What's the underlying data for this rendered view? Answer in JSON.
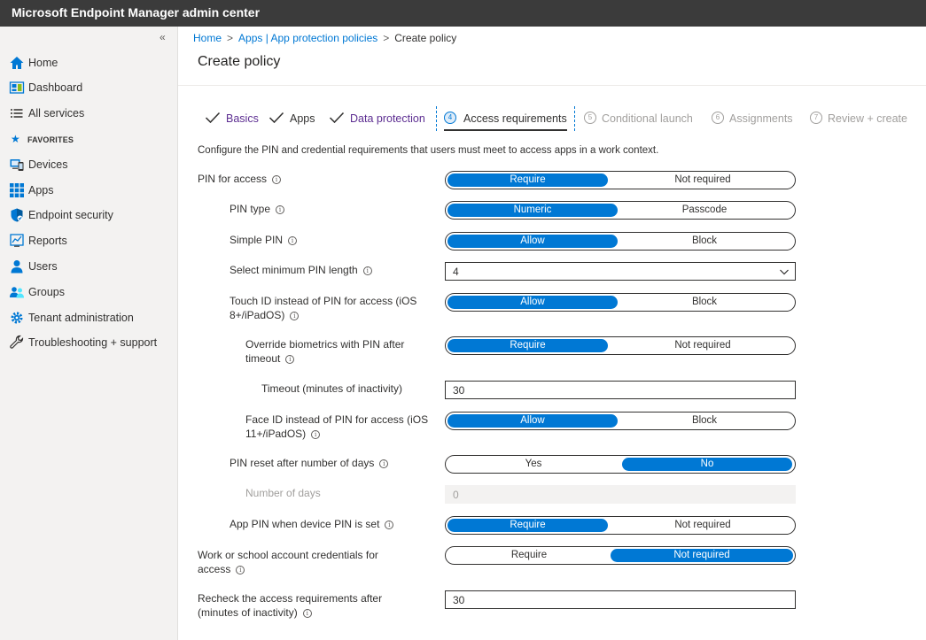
{
  "app": {
    "title": "Microsoft Endpoint Manager admin center"
  },
  "sidebar": {
    "collapse_glyph": "«",
    "favorites_label": "FAVORITES",
    "items": [
      {
        "label": "Home",
        "icon": "home-icon"
      },
      {
        "label": "Dashboard",
        "icon": "dashboard-icon"
      },
      {
        "label": "All services",
        "icon": "list-icon"
      },
      {
        "label": "Devices",
        "icon": "devices-icon"
      },
      {
        "label": "Apps",
        "icon": "apps-grid-icon"
      },
      {
        "label": "Endpoint security",
        "icon": "shield-icon"
      },
      {
        "label": "Reports",
        "icon": "reports-icon"
      },
      {
        "label": "Users",
        "icon": "user-icon"
      },
      {
        "label": "Groups",
        "icon": "groups-icon"
      },
      {
        "label": "Tenant administration",
        "icon": "tenant-gear-icon"
      },
      {
        "label": "Troubleshooting + support",
        "icon": "wrench-icon"
      }
    ]
  },
  "breadcrumb": {
    "home": "Home",
    "apps": "Apps | App protection policies",
    "current": "Create policy",
    "separator": ">"
  },
  "page": {
    "title": "Create policy"
  },
  "wizard": {
    "steps": [
      {
        "label": "Basics",
        "state": "done"
      },
      {
        "label": "Apps",
        "state": "done"
      },
      {
        "label": "Data protection",
        "state": "done"
      },
      {
        "number": "4",
        "label": "Access requirements",
        "state": "active"
      },
      {
        "number": "5",
        "label": "Conditional launch",
        "state": "upcoming"
      },
      {
        "number": "6",
        "label": "Assignments",
        "state": "upcoming"
      },
      {
        "number": "7",
        "label": "Review + create",
        "state": "upcoming"
      }
    ]
  },
  "form": {
    "description": "Configure the PIN and credential requirements that users must meet to access apps in a work context.",
    "info_glyph": "i",
    "pin_for_access": {
      "label": "PIN for access",
      "options": [
        "Require",
        "Not required"
      ],
      "selected": "Require"
    },
    "pin_type": {
      "label": "PIN type",
      "options": [
        "Numeric",
        "Passcode"
      ],
      "selected": "Numeric"
    },
    "simple_pin": {
      "label": "Simple PIN",
      "options": [
        "Allow",
        "Block"
      ],
      "selected": "Allow"
    },
    "min_pin_length": {
      "label": "Select minimum PIN length",
      "value": "4"
    },
    "touch_id": {
      "label_line1": "Touch ID instead of PIN for access (iOS",
      "label_line2": "8+/iPadOS)",
      "options": [
        "Allow",
        "Block"
      ],
      "selected": "Allow"
    },
    "override_biometrics": {
      "label_line1": "Override biometrics with PIN after",
      "label_line2": "timeout",
      "options": [
        "Require",
        "Not required"
      ],
      "selected": "Require"
    },
    "timeout": {
      "label": "Timeout (minutes of inactivity)",
      "value": "30"
    },
    "face_id": {
      "label_line1": "Face ID instead of PIN for access (iOS",
      "label_line2": "11+/iPadOS)",
      "options": [
        "Allow",
        "Block"
      ],
      "selected": "Allow"
    },
    "pin_reset": {
      "label": "PIN reset after number of days",
      "options": [
        "Yes",
        "No"
      ],
      "selected": "No"
    },
    "number_of_days": {
      "label": "Number of days",
      "value": "0"
    },
    "app_pin_device_pin": {
      "label": "App PIN when device PIN is set",
      "options": [
        "Require",
        "Not required"
      ],
      "selected": "Require"
    },
    "work_credentials": {
      "label_line1": "Work or school account credentials for",
      "label_line2": "access",
      "options": [
        "Require",
        "Not required"
      ],
      "selected": "Not required"
    },
    "recheck": {
      "label_line1": "Recheck the access requirements after",
      "label_line2": "(minutes of inactivity)",
      "value": "30"
    }
  },
  "colors": {
    "accent": "#0078d4",
    "topbar": "#3b3b3b",
    "sidebar": "#f3f2f1",
    "completed_step": "#5c2d91"
  }
}
